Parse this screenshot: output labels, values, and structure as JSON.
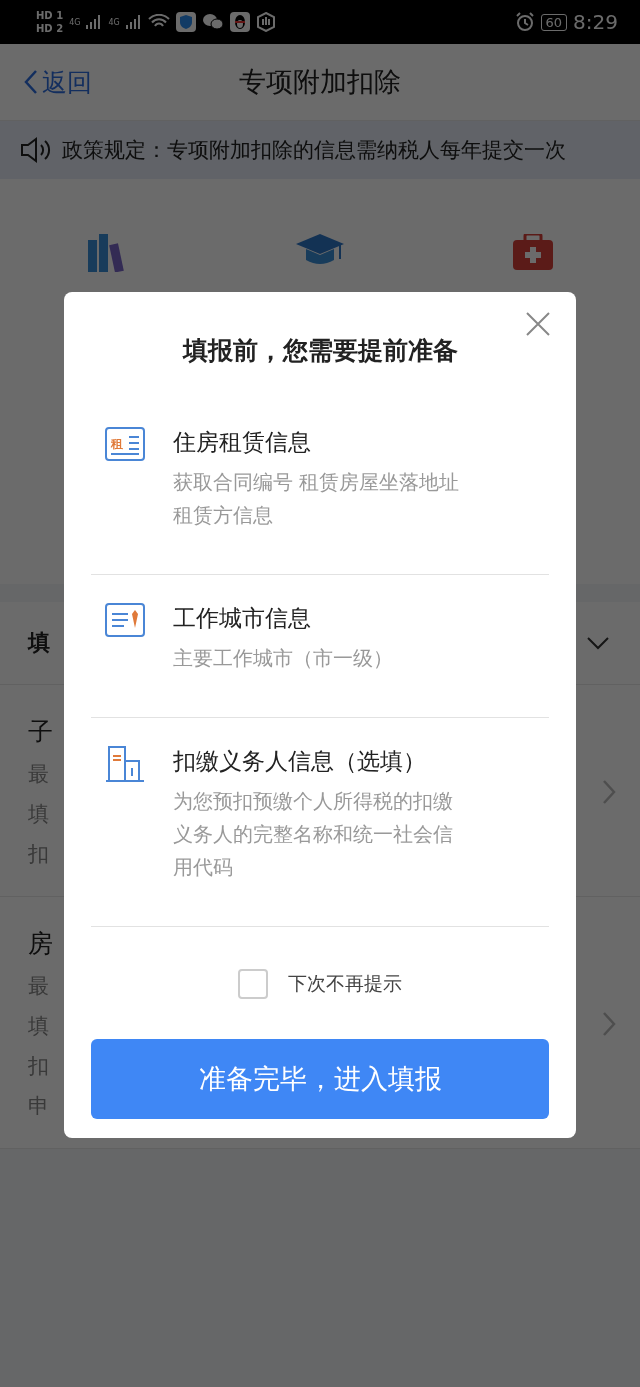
{
  "status_bar": {
    "sims": [
      {
        "label": "HD",
        "slot": "1"
      },
      {
        "label": "HD",
        "slot": "2"
      }
    ],
    "networks": [
      "4G",
      "4G"
    ],
    "battery": "60",
    "time": "8:29"
  },
  "nav": {
    "back": "返回",
    "title": "专项附加扣除"
  },
  "notice": "政策规定：专项附加扣除的信息需纳税人每年提交一次",
  "categories": [
    {
      "kind": "books"
    },
    {
      "kind": "cap"
    },
    {
      "kind": "kit"
    }
  ],
  "section": {
    "title": "填"
  },
  "items": [
    {
      "title": "子",
      "lines": [
        "最",
        "填",
        "扣"
      ]
    },
    {
      "title": "房",
      "lines": [
        "最",
        "填",
        "扣",
        "申"
      ]
    }
  ],
  "dialog": {
    "title": "填报前，您需要提前准备",
    "entries": [
      {
        "kind": "rent",
        "icon_text": "租",
        "title": "住房租赁信息",
        "description": "获取合同编号 租赁房屋坐落地址租赁方信息"
      },
      {
        "kind": "city",
        "title": "工作城市信息",
        "description": "主要工作城市（市一级）"
      },
      {
        "kind": "employer",
        "title": "扣缴义务人信息（选填）",
        "description": "为您预扣预缴个人所得税的扣缴义务人的完整名称和统一社会信用代码"
      }
    ],
    "checkbox": {
      "label": "下次不再提示",
      "checked": false
    },
    "button": "准备完毕，进入填报"
  }
}
